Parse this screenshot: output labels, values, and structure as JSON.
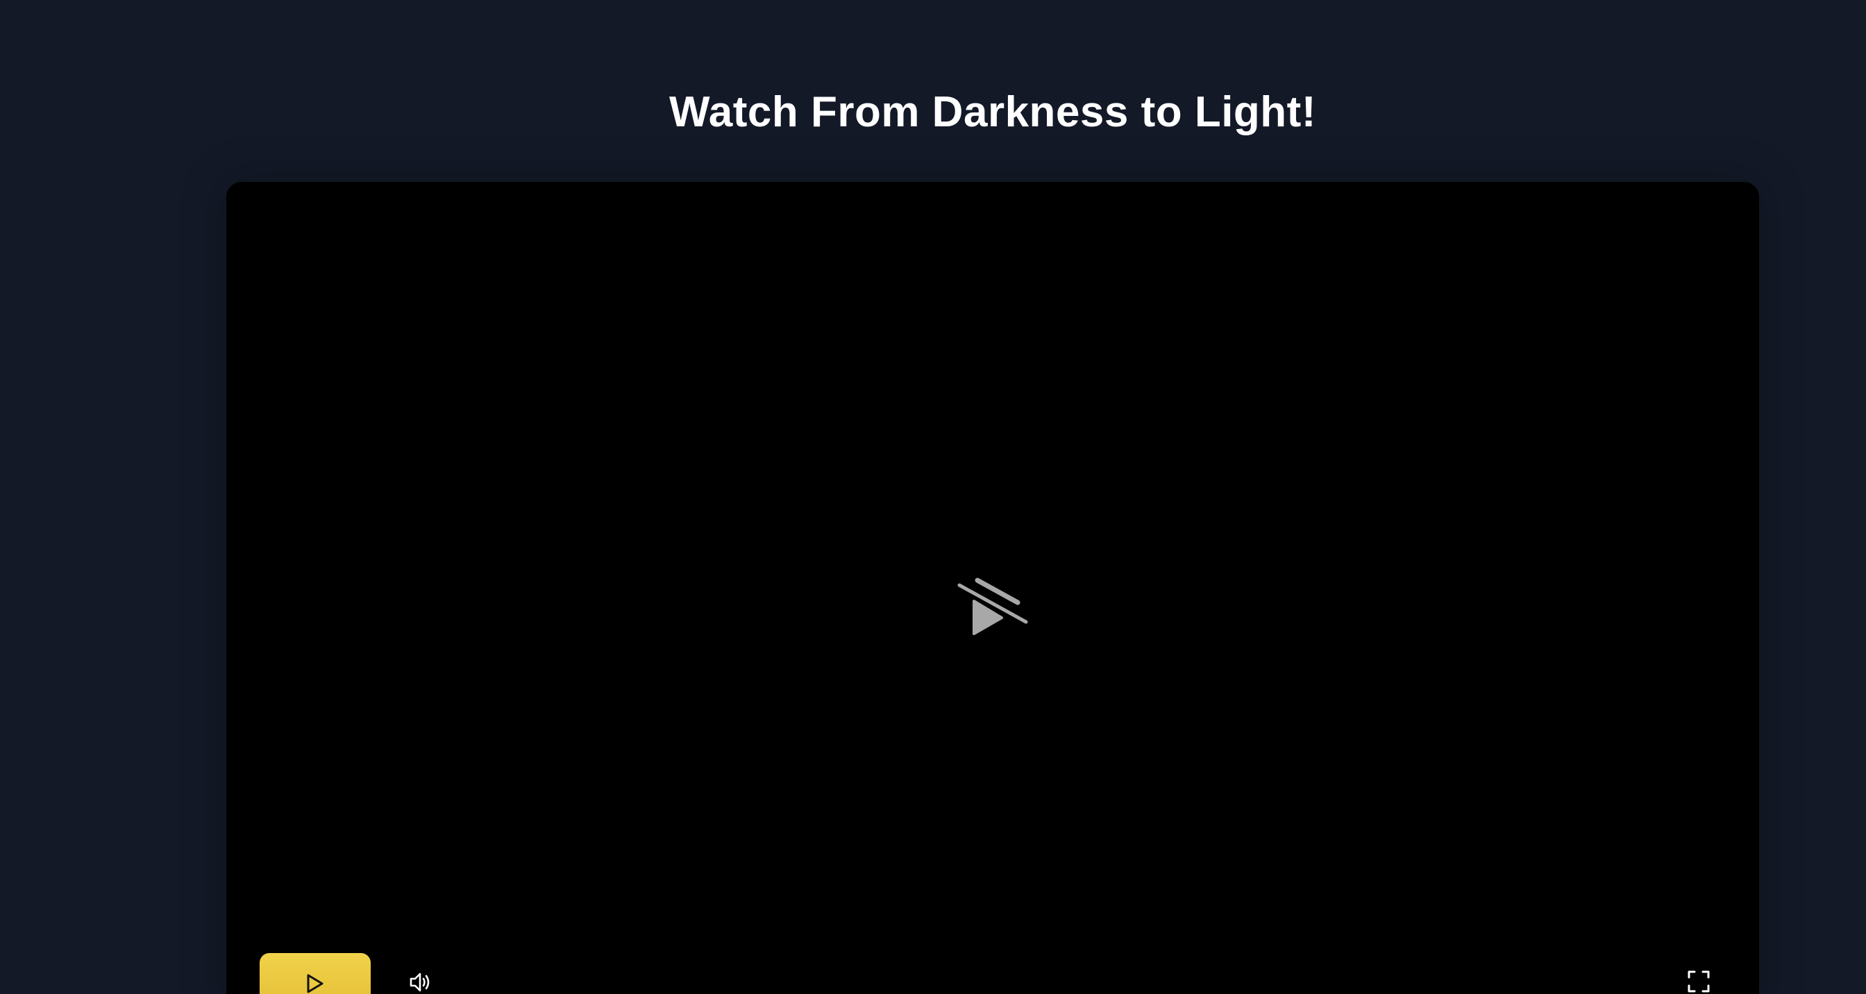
{
  "page": {
    "title": "Watch From Darkness to Light!",
    "background_color": "#131927"
  },
  "player": {
    "background_color": "#000000",
    "center_icon": "video-unavailable-icon",
    "controls": {
      "play_icon": "play-icon",
      "play_button_color": "#eac83f",
      "volume_icon": "volume-icon",
      "fullscreen_icon": "fullscreen-icon"
    }
  }
}
